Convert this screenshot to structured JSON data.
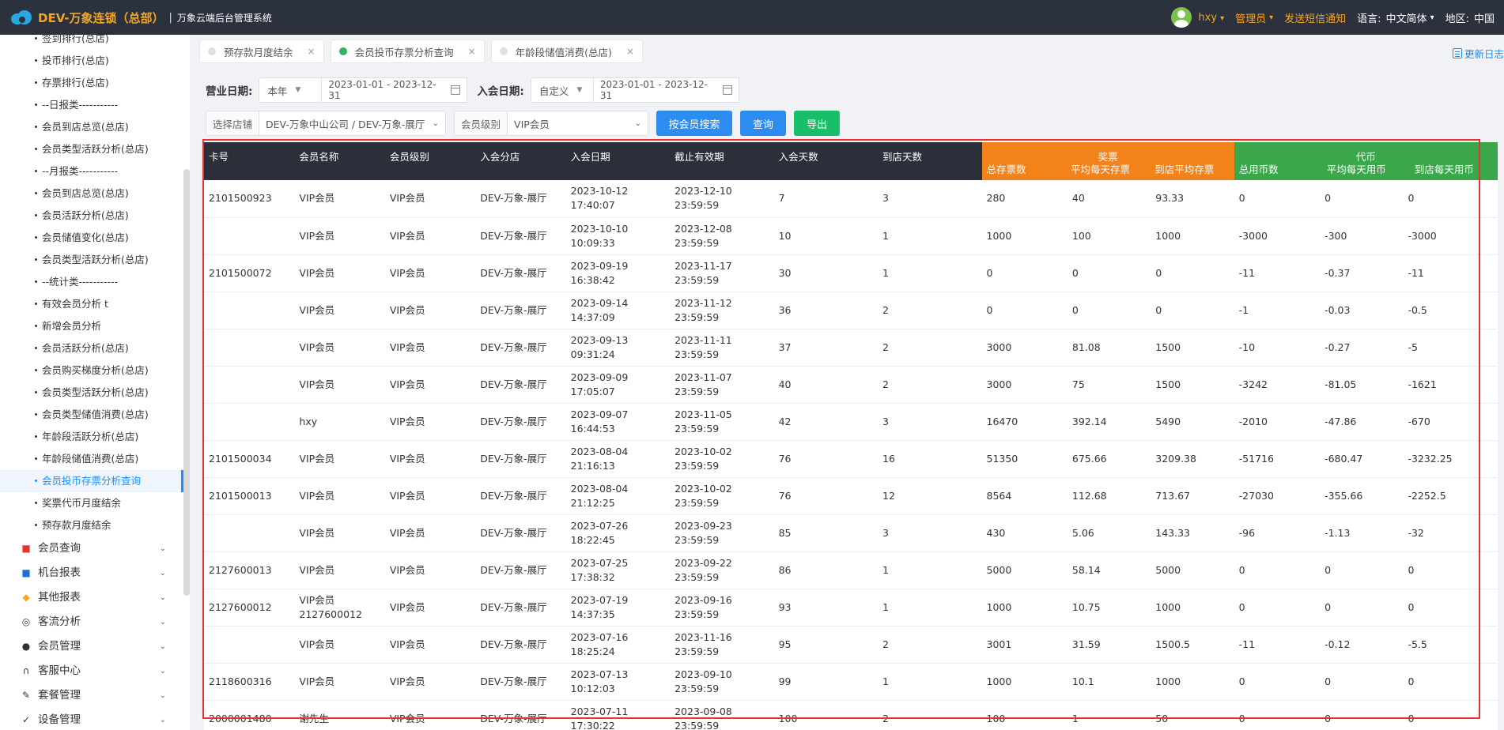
{
  "topbar": {
    "brand": "DEV-万象连锁（总部）",
    "separator": "|",
    "subtitle": "万象云端后台管理系统",
    "user": "hxy",
    "role": "管理员",
    "sms": "发送短信通知",
    "language_label": "语言:",
    "language_value": "中文简体",
    "region_label": "地区:",
    "region_value": "中国"
  },
  "sidebar": {
    "sub_items": [
      {
        "label": "签到排行(总店)",
        "active": false
      },
      {
        "label": "投币排行(总店)",
        "active": false
      },
      {
        "label": "存票排行(总店)",
        "active": false
      },
      {
        "label": "--日报类-----------",
        "active": false
      },
      {
        "label": "会员到店总览(总店)",
        "active": false
      },
      {
        "label": "会员类型活跃分析(总店)",
        "active": false
      },
      {
        "label": "--月报类-----------",
        "active": false
      },
      {
        "label": "会员到店总览(总店)",
        "active": false
      },
      {
        "label": "会员活跃分析(总店)",
        "active": false
      },
      {
        "label": "会员储值变化(总店)",
        "active": false
      },
      {
        "label": "会员类型活跃分析(总店)",
        "active": false
      },
      {
        "label": "--统计类-----------",
        "active": false
      },
      {
        "label": "有效会员分析 t",
        "active": false
      },
      {
        "label": "新增会员分析",
        "active": false
      },
      {
        "label": "会员活跃分析(总店)",
        "active": false
      },
      {
        "label": "会员购买梯度分析(总店)",
        "active": false
      },
      {
        "label": "会员类型活跃分析(总店)",
        "active": false
      },
      {
        "label": "会员类型储值消费(总店)",
        "active": false
      },
      {
        "label": "年龄段活跃分析(总店)",
        "active": false
      },
      {
        "label": "年龄段储值消费(总店)",
        "active": false
      },
      {
        "label": "会员投币存票分析查询",
        "active": true
      },
      {
        "label": "奖票代币月度结余",
        "active": false
      },
      {
        "label": "预存款月度结余",
        "active": false
      }
    ],
    "menus": [
      {
        "label": "会员查询",
        "icon": "member-query-icon",
        "glyph": "■",
        "color": "#e5322d"
      },
      {
        "label": "机台报表",
        "icon": "machine-report-icon",
        "glyph": "■",
        "color": "#1e6fd9"
      },
      {
        "label": "其他报表",
        "icon": "layers-icon",
        "glyph": "◆",
        "color": "#f5a623"
      },
      {
        "label": "客流分析",
        "icon": "target-icon",
        "glyph": "◎",
        "color": "#333"
      },
      {
        "label": "会员管理",
        "icon": "user-icon",
        "glyph": "●",
        "color": "#333"
      },
      {
        "label": "客服中心",
        "icon": "headset-icon",
        "glyph": "∩",
        "color": "#333"
      },
      {
        "label": "套餐管理",
        "icon": "edit-icon",
        "glyph": "✎",
        "color": "#333"
      },
      {
        "label": "设备管理",
        "icon": "wrench-icon",
        "glyph": "✓",
        "color": "#333"
      }
    ]
  },
  "tabs": [
    {
      "label": "预存款月度结余",
      "active": false
    },
    {
      "label": "会员投币存票分析查询",
      "active": true
    },
    {
      "label": "年龄段储值消费(总店)",
      "active": false
    }
  ],
  "tab_close": "×",
  "update_log": "更新日志",
  "filters": {
    "business_date_label": "营业日期:",
    "business_date_preset": "本年",
    "business_date_range": "2023-01-01 - 2023-12-31",
    "join_date_label": "入会日期:",
    "join_date_preset": "自定义",
    "join_date_range": "2023-01-01 - 2023-12-31",
    "store_label": "选择店铺",
    "store_value": "DEV-万象中山公司 / DEV-万象-展厅",
    "level_label": "会员级别",
    "level_value": "VIP会员",
    "btn_search_by_member": "按会员搜索",
    "btn_query": "查询",
    "btn_export": "导出"
  },
  "table": {
    "headers": {
      "card_no": "卡号",
      "member_name": "会员名称",
      "member_level": "会员级别",
      "join_store": "入会分店",
      "join_date": "入会日期",
      "expire": "截止有效期",
      "join_days": "入会天数",
      "visit_days": "到店天数",
      "ticket_group": "奖票",
      "ticket_total": "总存票数",
      "ticket_daily": "平均每天存票",
      "ticket_visit": "到店平均存票",
      "coin_group": "代币",
      "coin_total": "总用币数",
      "coin_daily": "平均每天用币",
      "coin_visit": "到店每天用币"
    },
    "rows": [
      {
        "card": "2101500923",
        "name": "VIP会员",
        "level": "VIP会员",
        "store": "DEV-万象-展厅",
        "join_date": "2023-10-12",
        "join_time": "17:40:07",
        "exp_date": "2023-12-10",
        "exp_time": "23:59:59",
        "days": "7",
        "visits": "3",
        "t_total": "280",
        "t_daily": "40",
        "t_visit": "93.33",
        "c_total": "0",
        "c_daily": "0",
        "c_visit": "0"
      },
      {
        "card": "",
        "name": "VIP会员",
        "level": "VIP会员",
        "store": "DEV-万象-展厅",
        "join_date": "2023-10-10",
        "join_time": "10:09:33",
        "exp_date": "2023-12-08",
        "exp_time": "23:59:59",
        "days": "10",
        "visits": "1",
        "t_total": "1000",
        "t_daily": "100",
        "t_visit": "1000",
        "c_total": "-3000",
        "c_daily": "-300",
        "c_visit": "-3000"
      },
      {
        "card": "2101500072",
        "name": "VIP会员",
        "level": "VIP会员",
        "store": "DEV-万象-展厅",
        "join_date": "2023-09-19",
        "join_time": "16:38:42",
        "exp_date": "2023-11-17",
        "exp_time": "23:59:59",
        "days": "30",
        "visits": "1",
        "t_total": "0",
        "t_daily": "0",
        "t_visit": "0",
        "c_total": "-11",
        "c_daily": "-0.37",
        "c_visit": "-11"
      },
      {
        "card": "",
        "name": "VIP会员",
        "level": "VIP会员",
        "store": "DEV-万象-展厅",
        "join_date": "2023-09-14",
        "join_time": "14:37:09",
        "exp_date": "2023-11-12",
        "exp_time": "23:59:59",
        "days": "36",
        "visits": "2",
        "t_total": "0",
        "t_daily": "0",
        "t_visit": "0",
        "c_total": "-1",
        "c_daily": "-0.03",
        "c_visit": "-0.5"
      },
      {
        "card": "",
        "name": "VIP会员",
        "level": "VIP会员",
        "store": "DEV-万象-展厅",
        "join_date": "2023-09-13",
        "join_time": "09:31:24",
        "exp_date": "2023-11-11",
        "exp_time": "23:59:59",
        "days": "37",
        "visits": "2",
        "t_total": "3000",
        "t_daily": "81.08",
        "t_visit": "1500",
        "c_total": "-10",
        "c_daily": "-0.27",
        "c_visit": "-5"
      },
      {
        "card": "",
        "name": "VIP会员",
        "level": "VIP会员",
        "store": "DEV-万象-展厅",
        "join_date": "2023-09-09",
        "join_time": "17:05:07",
        "exp_date": "2023-11-07",
        "exp_time": "23:59:59",
        "days": "40",
        "visits": "2",
        "t_total": "3000",
        "t_daily": "75",
        "t_visit": "1500",
        "c_total": "-3242",
        "c_daily": "-81.05",
        "c_visit": "-1621"
      },
      {
        "card": "",
        "name": "hxy",
        "level": "VIP会员",
        "store": "DEV-万象-展厅",
        "join_date": "2023-09-07",
        "join_time": "16:44:53",
        "exp_date": "2023-11-05",
        "exp_time": "23:59:59",
        "days": "42",
        "visits": "3",
        "t_total": "16470",
        "t_daily": "392.14",
        "t_visit": "5490",
        "c_total": "-2010",
        "c_daily": "-47.86",
        "c_visit": "-670"
      },
      {
        "card": "2101500034",
        "name": "VIP会员",
        "level": "VIP会员",
        "store": "DEV-万象-展厅",
        "join_date": "2023-08-04",
        "join_time": "21:16:13",
        "exp_date": "2023-10-02",
        "exp_time": "23:59:59",
        "days": "76",
        "visits": "16",
        "t_total": "51350",
        "t_daily": "675.66",
        "t_visit": "3209.38",
        "c_total": "-51716",
        "c_daily": "-680.47",
        "c_visit": "-3232.25"
      },
      {
        "card": "2101500013",
        "name": "VIP会员",
        "level": "VIP会员",
        "store": "DEV-万象-展厅",
        "join_date": "2023-08-04",
        "join_time": "21:12:25",
        "exp_date": "2023-10-02",
        "exp_time": "23:59:59",
        "days": "76",
        "visits": "12",
        "t_total": "8564",
        "t_daily": "112.68",
        "t_visit": "713.67",
        "c_total": "-27030",
        "c_daily": "-355.66",
        "c_visit": "-2252.5"
      },
      {
        "card": "",
        "name": "VIP会员",
        "level": "VIP会员",
        "store": "DEV-万象-展厅",
        "join_date": "2023-07-26",
        "join_time": "18:22:45",
        "exp_date": "2023-09-23",
        "exp_time": "23:59:59",
        "days": "85",
        "visits": "3",
        "t_total": "430",
        "t_daily": "5.06",
        "t_visit": "143.33",
        "c_total": "-96",
        "c_daily": "-1.13",
        "c_visit": "-32"
      },
      {
        "card": "2127600013",
        "name": "VIP会员",
        "level": "VIP会员",
        "store": "DEV-万象-展厅",
        "join_date": "2023-07-25",
        "join_time": "17:38:32",
        "exp_date": "2023-09-22",
        "exp_time": "23:59:59",
        "days": "86",
        "visits": "1",
        "t_total": "5000",
        "t_daily": "58.14",
        "t_visit": "5000",
        "c_total": "0",
        "c_daily": "0",
        "c_visit": "0"
      },
      {
        "card": "2127600012",
        "name": "VIP会员 2127600012",
        "level": "VIP会员",
        "store": "DEV-万象-展厅",
        "join_date": "2023-07-19",
        "join_time": "14:37:35",
        "exp_date": "2023-09-16",
        "exp_time": "23:59:59",
        "days": "93",
        "visits": "1",
        "t_total": "1000",
        "t_daily": "10.75",
        "t_visit": "1000",
        "c_total": "0",
        "c_daily": "0",
        "c_visit": "0"
      },
      {
        "card": "",
        "name": "VIP会员",
        "level": "VIP会员",
        "store": "DEV-万象-展厅",
        "join_date": "2023-07-16",
        "join_time": "18:25:24",
        "exp_date": "2023-11-16",
        "exp_time": "23:59:59",
        "days": "95",
        "visits": "2",
        "t_total": "3001",
        "t_daily": "31.59",
        "t_visit": "1500.5",
        "c_total": "-11",
        "c_daily": "-0.12",
        "c_visit": "-5.5"
      },
      {
        "card": "2118600316",
        "name": "VIP会员",
        "level": "VIP会员",
        "store": "DEV-万象-展厅",
        "join_date": "2023-07-13",
        "join_time": "10:12:03",
        "exp_date": "2023-09-10",
        "exp_time": "23:59:59",
        "days": "99",
        "visits": "1",
        "t_total": "1000",
        "t_daily": "10.1",
        "t_visit": "1000",
        "c_total": "0",
        "c_daily": "0",
        "c_visit": "0"
      },
      {
        "card": "2000001480",
        "name": "谢先生",
        "level": "VIP会员",
        "store": "DEV-万象-展厅",
        "join_date": "2023-07-11",
        "join_time": "17:30:22",
        "exp_date": "2023-09-08",
        "exp_time": "23:59:59",
        "days": "100",
        "visits": "2",
        "t_total": "100",
        "t_daily": "1",
        "t_visit": "50",
        "c_total": "0",
        "c_daily": "0",
        "c_visit": "0"
      }
    ]
  },
  "colors": {
    "topbar_bg": "#2b313d",
    "brand": "#f5a623",
    "header_dark": "#2b2f3a",
    "header_orange": "#f2821a",
    "header_green": "#3aa84a",
    "primary_blue": "#2d8cf0",
    "export_green": "#19be6b",
    "highlight_red": "#e5322d"
  }
}
